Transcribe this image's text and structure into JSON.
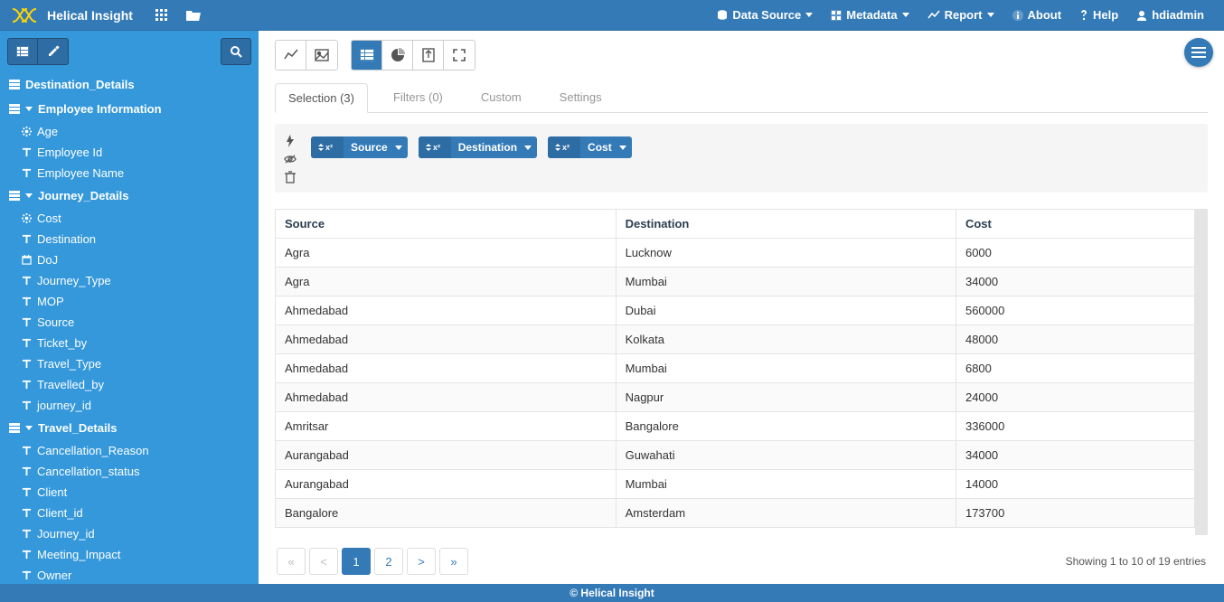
{
  "brand": "Helical Insight",
  "nav": {
    "data_source": "Data Source",
    "metadata": "Metadata",
    "report": "Report",
    "about": "About",
    "help": "Help",
    "user": "hdiadmin"
  },
  "sidebar": {
    "groups": [
      {
        "name": "Destination_Details",
        "expanded": false,
        "items": []
      },
      {
        "name": "Employee Information",
        "expanded": true,
        "items": [
          {
            "icon": "gear",
            "label": "Age"
          },
          {
            "icon": "text",
            "label": "Employee Id"
          },
          {
            "icon": "text",
            "label": "Employee Name"
          }
        ]
      },
      {
        "name": "Journey_Details",
        "expanded": true,
        "items": [
          {
            "icon": "gear",
            "label": "Cost"
          },
          {
            "icon": "text",
            "label": "Destination"
          },
          {
            "icon": "calendar",
            "label": "DoJ"
          },
          {
            "icon": "text",
            "label": "Journey_Type"
          },
          {
            "icon": "text",
            "label": "MOP"
          },
          {
            "icon": "text",
            "label": "Source"
          },
          {
            "icon": "text",
            "label": "Ticket_by"
          },
          {
            "icon": "text",
            "label": "Travel_Type"
          },
          {
            "icon": "text",
            "label": "Travelled_by"
          },
          {
            "icon": "text",
            "label": "journey_id"
          }
        ]
      },
      {
        "name": "Travel_Details",
        "expanded": true,
        "items": [
          {
            "icon": "text",
            "label": "Cancellation_Reason"
          },
          {
            "icon": "text",
            "label": "Cancellation_status"
          },
          {
            "icon": "text",
            "label": "Client"
          },
          {
            "icon": "text",
            "label": "Client_id"
          },
          {
            "icon": "text",
            "label": "Journey_id"
          },
          {
            "icon": "text",
            "label": "Meeting_Impact"
          },
          {
            "icon": "text",
            "label": "Owner"
          }
        ]
      }
    ]
  },
  "tabs": {
    "selection": "Selection (3)",
    "filters": "Filters (0)",
    "custom": "Custom",
    "settings": "Settings"
  },
  "chips": [
    "Source",
    "Destination",
    "Cost"
  ],
  "table": {
    "columns": [
      "Source",
      "Destination",
      "Cost"
    ],
    "rows": [
      [
        "Agra",
        "Lucknow",
        "6000"
      ],
      [
        "Agra",
        "Mumbai",
        "34000"
      ],
      [
        "Ahmedabad",
        "Dubai",
        "560000"
      ],
      [
        "Ahmedabad",
        "Kolkata",
        "48000"
      ],
      [
        "Ahmedabad",
        "Mumbai",
        "6800"
      ],
      [
        "Ahmedabad",
        "Nagpur",
        "24000"
      ],
      [
        "Amritsar",
        "Bangalore",
        "336000"
      ],
      [
        "Aurangabad",
        "Guwahati",
        "34000"
      ],
      [
        "Aurangabad",
        "Mumbai",
        "14000"
      ],
      [
        "Bangalore",
        "Amsterdam",
        "173700"
      ]
    ]
  },
  "pager": {
    "first": "«",
    "prev": "<",
    "p1": "1",
    "p2": "2",
    "next": ">",
    "last": "»",
    "info": "Showing 1 to 10 of 19 entries"
  },
  "footer": "© Helical Insight"
}
